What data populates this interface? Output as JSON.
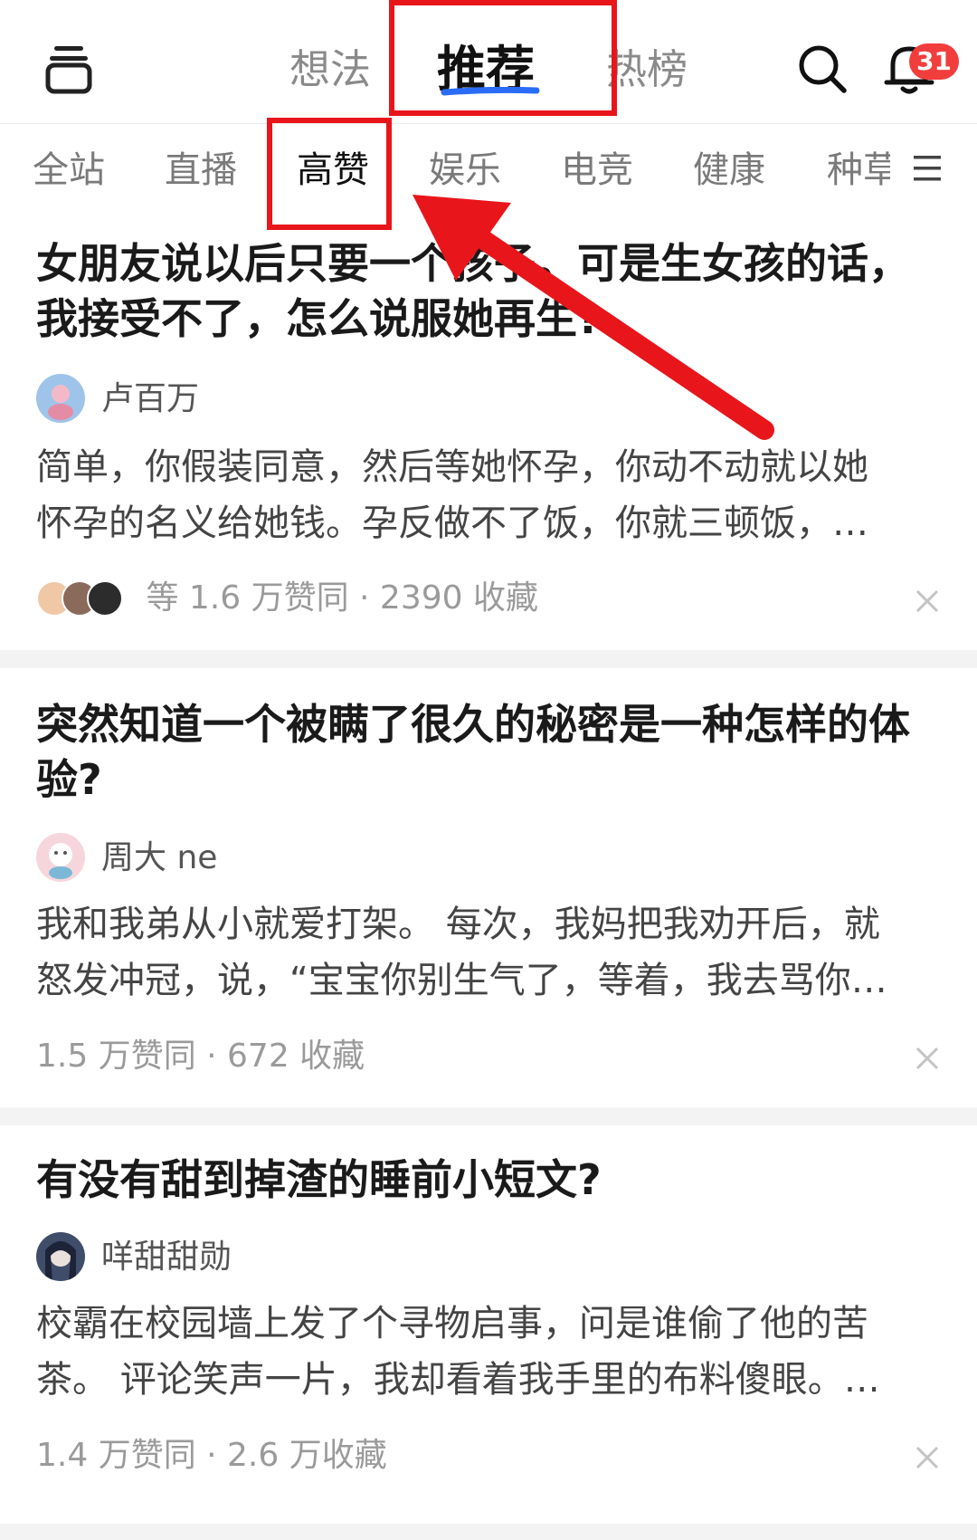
{
  "header": {
    "tabs": [
      {
        "label": "想法",
        "active": false
      },
      {
        "label": "推荐",
        "active": true
      },
      {
        "label": "热榜",
        "active": false
      }
    ],
    "notification_count": "31",
    "icons": [
      "menu-icon",
      "search-icon",
      "bell-icon"
    ],
    "accent_color": "#2a6cf6",
    "badge_color": "#f23d3d"
  },
  "categories": [
    {
      "label": "全站",
      "active": false
    },
    {
      "label": "直播",
      "active": false
    },
    {
      "label": "高赞",
      "active": true
    },
    {
      "label": "娱乐",
      "active": false
    },
    {
      "label": "电竞",
      "active": false
    },
    {
      "label": "健康",
      "active": false
    },
    {
      "label": "种草",
      "active": false
    }
  ],
  "feed": [
    {
      "title": "女朋友说以后只要一个孩子。可是生女孩的话，我接受不了，怎么说服她再生?",
      "author": "卢百万",
      "excerpt_lines": [
        "简单，你假装同意，然后等她怀孕，你动不动就以她",
        "怀孕的名义给她钱。孕反做不了饭，你就三顿饭，…"
      ],
      "meta": "等 1.6 万赞同 · 2390 收藏"
    },
    {
      "title": "突然知道一个被瞒了很久的秘密是一种怎样的体验?",
      "author": "周大 ne",
      "excerpt_lines": [
        "我和我弟从小就爱打架。 每次，我妈把我劝开后，就",
        "怒发冲冠，说，“宝宝你别生气了，等着，我去骂你…"
      ],
      "meta": "1.5 万赞同 · 672 收藏"
    },
    {
      "title": "有没有甜到掉渣的睡前小短文?",
      "author": "咩甜甜勋",
      "excerpt_lines": [
        "校霸在校园墙上发了个寻物启事，问是谁偷了他的苦",
        "茶。 评论笑声一片，我却看着我手里的布料傻眼。…"
      ],
      "meta": "1.4 万赞同 · 2.6 万收藏"
    }
  ],
  "annotation_color": "#e8151b"
}
